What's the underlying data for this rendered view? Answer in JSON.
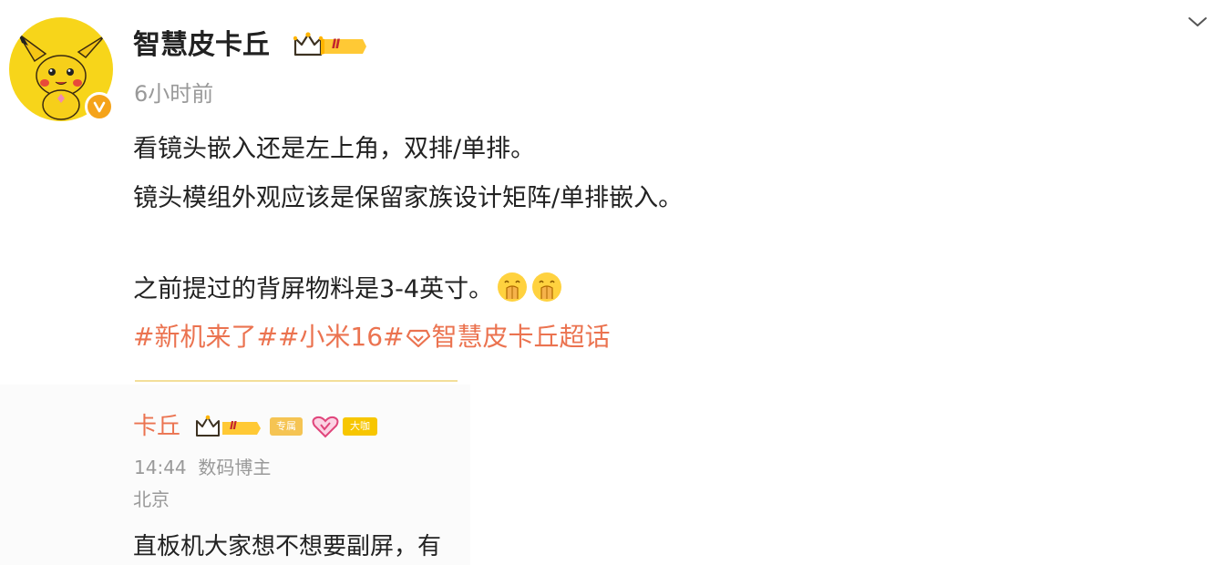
{
  "author": {
    "name": "智慧皮卡丘",
    "level_badge": "Ⅱ",
    "time": "6小时前",
    "verified_icon": "v-verified-badge"
  },
  "post": {
    "lines": [
      "看镜头嵌入还是左上角，双排/单排。",
      "镜头模组外观应该是保留家族设计矩阵/单排嵌入。",
      "之前提过的背屏物料是3-4英寸。"
    ],
    "emojis": [
      "rubbing-palms-emoji",
      "rubbing-palms-emoji"
    ],
    "tags": {
      "tag1": "#新机来了#",
      "tag2": "#小米16#",
      "supertopic": "智慧皮卡丘超话"
    }
  },
  "quoted": {
    "name": "卡丘",
    "level_badge": "Ⅱ",
    "badge2": "专属",
    "badge3": "大咖",
    "time": "14:44",
    "role": "数码博主",
    "location": "北京",
    "text": "直板机大家想不想要副屏，有"
  },
  "colors": {
    "accent": "#eb7350",
    "avatar_bg": "#f7d51a",
    "verified": "#f5a31a",
    "muted": "#999999"
  }
}
